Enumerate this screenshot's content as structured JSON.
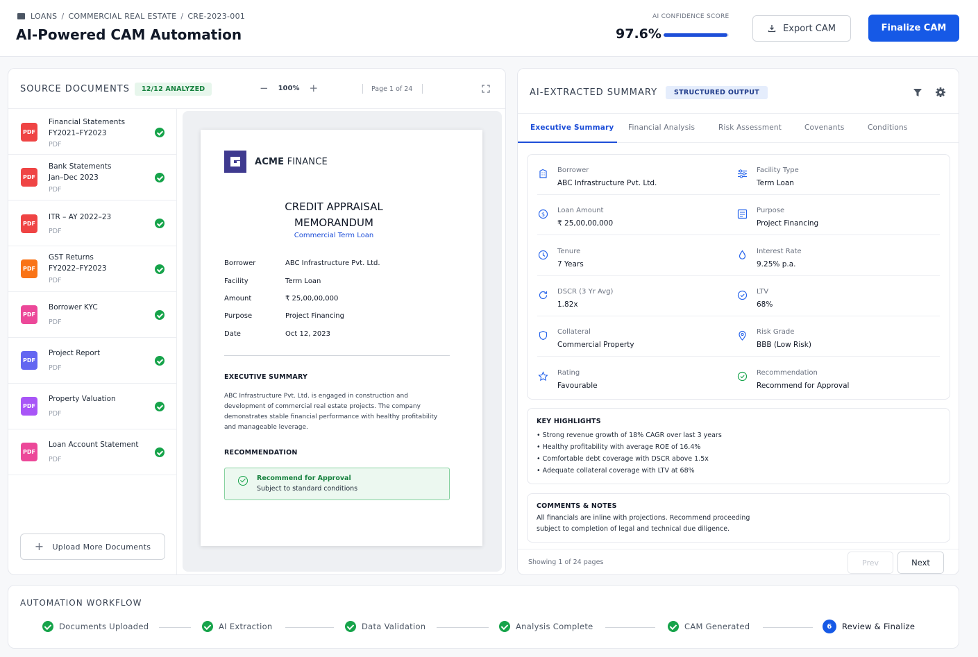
{
  "header": {
    "breadcrumb": [
      "LOANS",
      "COMMERCIAL REAL ESTATE",
      "CRE-2023-001"
    ],
    "title": "AI-Powered CAM Automation",
    "confidence_label": "AI CONFIDENCE SCORE",
    "confidence_value": "97.6%",
    "confidence_fraction": 0.976,
    "export_label": "Export CAM",
    "finalize_label": "Finalize CAM"
  },
  "source": {
    "title": "SOURCE DOCUMENTS",
    "badge": "12/12 ANALYZED",
    "zoom": "100%",
    "zoom_minus": "−",
    "zoom_plus": "+",
    "page_info": "Page 1 of 24",
    "documents": [
      {
        "name": "Financial Statements",
        "sub": "FY2021–FY2023",
        "type": "PDF",
        "color": "#ef4444"
      },
      {
        "name": "Bank Statements",
        "sub": "Jan–Dec 2023",
        "type": "PDF",
        "color": "#ef4444"
      },
      {
        "name": "ITR – AY 2022–23",
        "sub": "",
        "type": "PDF",
        "color": "#ef4444"
      },
      {
        "name": "GST Returns",
        "sub": "FY2022–FY2023",
        "type": "PDF",
        "color": "#f97316"
      },
      {
        "name": "Borrower KYC",
        "sub": "",
        "type": "PDF",
        "color": "#ec4899"
      },
      {
        "name": "Project Report",
        "sub": "",
        "type": "PDF",
        "color": "#6366f1"
      },
      {
        "name": "Property Valuation",
        "sub": "",
        "type": "PDF",
        "color": "#a855f7"
      },
      {
        "name": "Loan Account Statement",
        "sub": "",
        "type": "PDF",
        "color": "#ec4899"
      }
    ],
    "upload_label": "Upload More Documents"
  },
  "memo": {
    "brand_bold": "ACME",
    "brand_light": "FINANCE",
    "title_line1": "CREDIT APPRAISAL",
    "title_line2": "MEMORANDUM",
    "subtitle": "Commercial Term Loan",
    "fields": [
      {
        "k": "Borrower",
        "v": "ABC Infrastructure Pvt. Ltd."
      },
      {
        "k": "Facility",
        "v": "Term Loan"
      },
      {
        "k": "Amount",
        "v": "₹ 25,00,00,000"
      },
      {
        "k": "Purpose",
        "v": "Project Financing"
      },
      {
        "k": "Date",
        "v": "Oct 12, 2023"
      }
    ],
    "exec_heading": "EXECUTIVE SUMMARY",
    "exec_text": "ABC Infrastructure Pvt. Ltd. is engaged in construction and development of commercial real estate projects. The company demonstrates stable financial performance with healthy profitability and manageable leverage.",
    "rec_heading": "RECOMMENDATION",
    "rec_title": "Recommend for Approval",
    "rec_sub": "Subject to standard conditions"
  },
  "summary": {
    "title": "AI-EXTRACTED SUMMARY",
    "badge": "STRUCTURED OUTPUT",
    "tabs": [
      "Executive Summary",
      "Financial Analysis",
      "Risk Assessment",
      "Covenants",
      "Conditions"
    ],
    "rows": [
      [
        {
          "label": "Borrower",
          "value": "ABC Infrastructure Pvt. Ltd.",
          "icon": "building-icon"
        },
        {
          "label": "Facility Type",
          "value": "Term Loan",
          "icon": "sliders-icon"
        }
      ],
      [
        {
          "label": "Loan Amount",
          "value": "₹ 25,00,00,000",
          "icon": "dollar-circle-icon"
        },
        {
          "label": "Purpose",
          "value": "Project Financing",
          "icon": "document-icon"
        }
      ],
      [
        {
          "label": "Tenure",
          "value": "7 Years",
          "icon": "clock-icon"
        },
        {
          "label": "Interest Rate",
          "value": "9.25% p.a.",
          "icon": "droplet-icon"
        }
      ],
      [
        {
          "label": "DSCR (3 Yr Avg)",
          "value": "1.82x",
          "icon": "refresh-icon"
        },
        {
          "label": "LTV",
          "value": "68%",
          "icon": "check-badge-icon"
        }
      ],
      [
        {
          "label": "Collateral",
          "value": "Commercial Property",
          "icon": "shield-icon"
        },
        {
          "label": "Risk Grade",
          "value": "BBB (Low Risk)",
          "icon": "location-pin-icon"
        }
      ],
      [
        {
          "label": "Rating",
          "value": "Favourable",
          "icon": "star-icon"
        },
        {
          "label": "Recommendation",
          "value": "Recommend for Approval",
          "icon": "check-circle-icon"
        }
      ]
    ],
    "highlights_title": "KEY HIGHLIGHTS",
    "highlights": [
      "• Strong revenue growth of 18% CAGR over last 3 years",
      "• Healthy profitability with average ROE of 16.4%",
      "• Comfortable debt coverage with DSCR above 1.5x",
      "• Adequate collateral coverage with LTV at 68%"
    ],
    "comments_title": "COMMENTS & NOTES",
    "comments_text": "All financials are inline with projections. Recommend proceeding subject to completion of legal and technical due diligence.",
    "showing": "Showing 1 of 24 pages",
    "prev_label": "Prev",
    "next_label": "Next"
  },
  "workflow": {
    "title": "AUTOMATION WORKFLOW",
    "steps": [
      {
        "label": "Documents Uploaded",
        "done": true
      },
      {
        "label": "AI Extraction",
        "done": true
      },
      {
        "label": "Data Validation",
        "done": true
      },
      {
        "label": "Analysis Complete",
        "done": true
      },
      {
        "label": "CAM Generated",
        "done": true
      },
      {
        "label": "Review & Finalize",
        "done": false,
        "number": "6"
      }
    ]
  },
  "colors": {
    "primary": "#1659e6",
    "success": "#16a34a",
    "accent_blue": "#1d4ed8"
  }
}
